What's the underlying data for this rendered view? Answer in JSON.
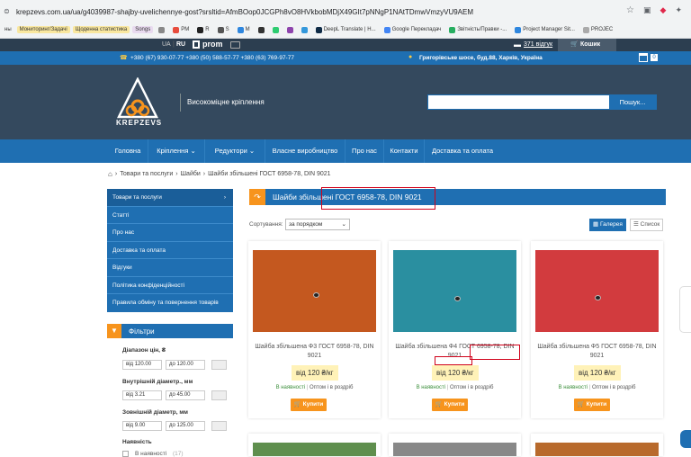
{
  "browser": {
    "url": "krepzevs.com.ua/ua/g4039987-shajby-uvelichennye-gost?srsltid=AfmBOop0JCGPh8vO8HVkbobMDjX49GIt7pNNgP1NAtTDmwVmzyVU9AEM",
    "bookmarks": [
      "ны",
      "Мониторинг/Задачі",
      "Щоденна статистика",
      "Songs",
      "PM",
      "R",
      "S",
      "M",
      "DeepL Translate | Н...",
      "Google Перекладач",
      "Звітність/Правки -...",
      "Project Manager Sit...",
      "PROJEC"
    ]
  },
  "topbar": {
    "lang_ua": "UA",
    "lang_ru": "RU",
    "prom": "prom",
    "reviews": "371 відгук",
    "cart": "Кошик"
  },
  "info": {
    "phones": "+380 (67) 930-07-77   +380 (50) 588-57-77   +380 (63) 769-97-77",
    "address": "Григорівське шосе, буд.88, Харків, Україна",
    "cart_count": "0"
  },
  "header": {
    "tagline": "Високоміцне кріплення",
    "logo_text": "KREPZEVS",
    "search_button": "Пошук..."
  },
  "nav": [
    "Головна",
    "Кріплення",
    "Редуктори",
    "Власне виробництво",
    "Про нас",
    "Контакти",
    "Доставка та оплата"
  ],
  "breadcrumb": [
    "Товари та послуги",
    "Шайби",
    "Шайби збільшені ГОСТ 6958-78, DIN 9021"
  ],
  "sidebar": {
    "items": [
      "Товари та послуги",
      "Статті",
      "Про нас",
      "Доставка та оплата",
      "Відгуки",
      "Політика конфіденційності",
      "Правила обміну та повернення товарів"
    ],
    "filters_title": "Фільтри",
    "price_label": "Діапазон цін, ₴",
    "price_from": "від 120.00",
    "price_to": "до 120.00",
    "inner_label": "Внутрішній діаметр., мм",
    "inner_from": "від 3.21",
    "inner_to": "до 45.00",
    "outer_label": "Зовнішній діаметр, мм",
    "outer_from": "від 9.00",
    "outer_to": "до 125.00",
    "avail_label": "Наявність",
    "avail_opt": "В наявності",
    "avail_count": "(17)"
  },
  "main": {
    "title": "Шайби збільшені ГОСТ 6958-78, DIN 9021",
    "sort_label": "Сортування:",
    "sort_value": "за порядком",
    "gallery": "Галерея",
    "list": "Список"
  },
  "products": [
    {
      "name": "Шайба збільшена Ф3 ГОСТ 6958-78, DIN 9021",
      "price": "від 120 ₴/кг",
      "in_stock": "В наявності",
      "wholesale": "Оптом і в роздріб",
      "buy": "Купити",
      "color": "#c4581f"
    },
    {
      "name": "Шайба збільшена Ф4 ГОСТ 6958-78, DIN 9021",
      "price": "від 120 ₴/кг",
      "in_stock": "В наявності",
      "wholesale": "Оптом і в роздріб",
      "buy": "Купити",
      "color": "#2a8fa0"
    },
    {
      "name": "Шайба збільшена Ф5 ГОСТ 6958-78, DIN 9021",
      "price": "від 120 ₴/кг",
      "in_stock": "В наявності",
      "wholesale": "Оптом і в роздріб",
      "buy": "Купити",
      "color": "#d23b3e"
    }
  ],
  "colors": {
    "brand_blue": "#1f6fb2",
    "header_dark": "#34495e",
    "accent_orange": "#f7941d",
    "stock_green": "#3c8f3c"
  }
}
